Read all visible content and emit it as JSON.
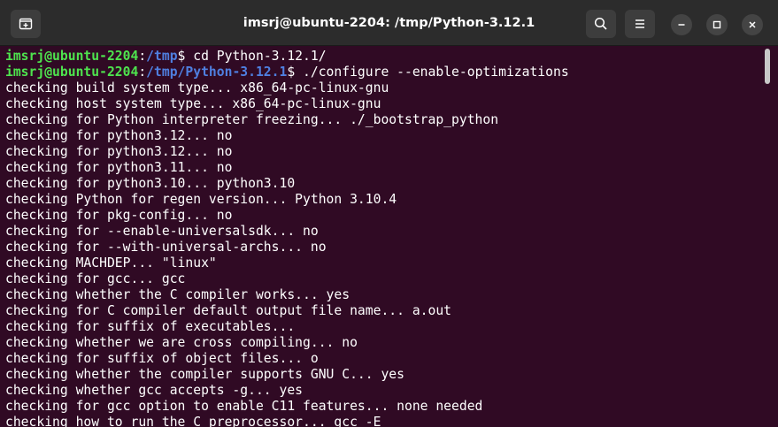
{
  "window": {
    "title": "imsrj@ubuntu-2204: /tmp/Python-3.12.1"
  },
  "prompts": [
    {
      "user": "imsrj@ubuntu-2204",
      "sep": ":",
      "path": "/tmp",
      "symbol": "$",
      "command": " cd Python-3.12.1/"
    },
    {
      "user": "imsrj@ubuntu-2204",
      "sep": ":",
      "path": "/tmp/Python-3.12.1",
      "symbol": "$",
      "command": " ./configure --enable-optimizations"
    }
  ],
  "output": [
    "checking build system type... x86_64-pc-linux-gnu",
    "checking host system type... x86_64-pc-linux-gnu",
    "checking for Python interpreter freezing... ./_bootstrap_python",
    "checking for python3.12... no",
    "checking for python3.12... no",
    "checking for python3.11... no",
    "checking for python3.10... python3.10",
    "checking Python for regen version... Python 3.10.4",
    "checking for pkg-config... no",
    "checking for --enable-universalsdk... no",
    "checking for --with-universal-archs... no",
    "checking MACHDEP... \"linux\"",
    "checking for gcc... gcc",
    "checking whether the C compiler works... yes",
    "checking for C compiler default output file name... a.out",
    "checking for suffix of executables...",
    "checking whether we are cross compiling... no",
    "checking for suffix of object files... o",
    "checking whether the compiler supports GNU C... yes",
    "checking whether gcc accepts -g... yes",
    "checking for gcc option to enable C11 features... none needed",
    "checking how to run the C preprocessor... gcc -E"
  ],
  "colors": {
    "background": "#300a24",
    "user": "#4ee34e",
    "path": "#4f7fe0",
    "text": "#ffffff"
  },
  "icons": {
    "new_tab": "new-tab-icon",
    "search": "search-icon",
    "menu": "hamburger-menu-icon",
    "minimize": "minimize-icon",
    "maximize": "maximize-icon",
    "close": "close-icon"
  }
}
